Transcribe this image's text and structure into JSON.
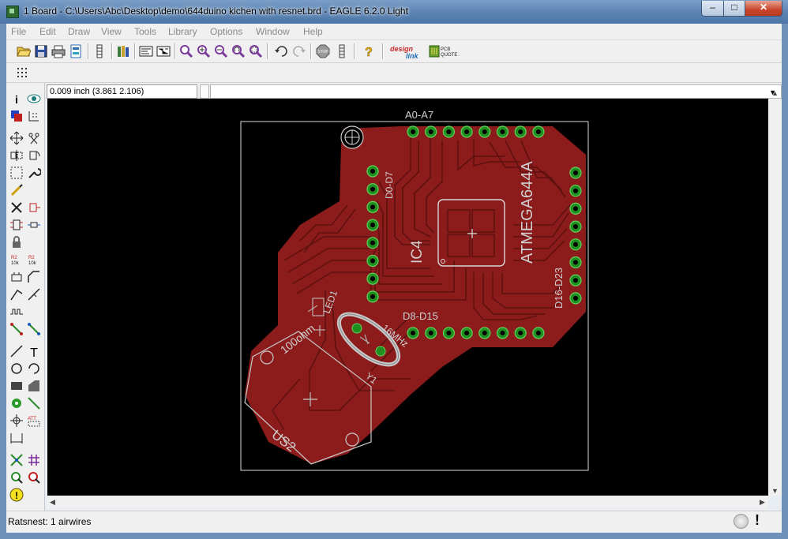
{
  "window": {
    "title": "1 Board - C:\\Users\\Abc\\Desktop\\demo\\644duino kichen with resnet.brd - EAGLE 6.2.0 Light",
    "minimize": "–",
    "maximize": "□",
    "close": "✕"
  },
  "menu": [
    {
      "label": "File"
    },
    {
      "label": "Edit"
    },
    {
      "label": "Draw"
    },
    {
      "label": "View"
    },
    {
      "label": "Tools"
    },
    {
      "label": "Library"
    },
    {
      "label": "Options"
    },
    {
      "label": "Window"
    },
    {
      "label": "Help"
    }
  ],
  "toolbar": {
    "icons": [
      "open-icon",
      "save-icon",
      "print-icon",
      "cam-icon",
      "tool-icon",
      "library-icon",
      "board-icon",
      "schematic-icon",
      "zoom-fit-icon",
      "zoom-in-icon",
      "zoom-out-icon",
      "zoom-redraw-icon",
      "zoom-select-icon",
      "undo-icon",
      "redo-icon",
      "stop-icon",
      "go-icon",
      "help-icon",
      "design-link-icon",
      "pcb-quote-icon"
    ],
    "design_link_label": "design link",
    "pcb_quote_label": "PCB QUOTE"
  },
  "coord": {
    "value": "0.009 inch (3.861 2.106)"
  },
  "board": {
    "label_a0": "A0-A7",
    "label_d0": "D0-D7",
    "label_ic": "IC4",
    "label_atmega": "ATMEGA644A",
    "label_d16": "D16-D23",
    "label_d8": "D8-D15",
    "label_16mhz": "16MHz",
    "label_100ohm": "100ohm",
    "label_led": "LED1",
    "label_y1": "Y1",
    "label_us2": "US2",
    "copper_color": "#8c1c1c",
    "trace_color": "#6e1212",
    "pad_color": "#2ba02b"
  },
  "status": {
    "text": "Ratsnest: 1 airwires"
  }
}
